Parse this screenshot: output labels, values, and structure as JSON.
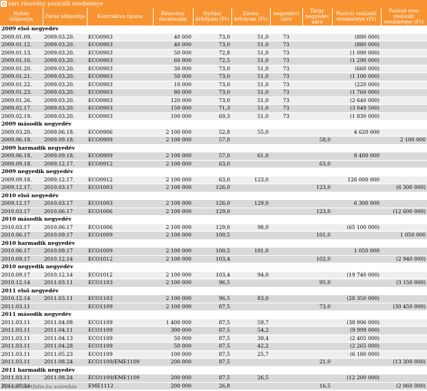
{
  "title": "zárt részvény pozíciók eredménye",
  "source": "Forrás: Portfolio.hu számítás",
  "headers": [
    "Nyitás időpontja",
    "Zárás időpontja",
    "Kontraktus típusa",
    "Részvény darabszám",
    "Nyitási árfolyam (Ft)",
    "Zárási árfolyam (Ft)",
    "negyedévi záró",
    "Tárgy negyedév záró",
    "Pozíció realizált eredménye (Ft)",
    "Pozíció nem realizált eredménye (Ft)"
  ],
  "rows": [
    {
      "q": "2009 első negyedév"
    },
    {
      "c": [
        "2009.01.09.",
        "2009.03.20.",
        "ECO0903",
        "40 000",
        "73,0",
        "51,0",
        "73",
        "",
        "(880 000)",
        ""
      ]
    },
    {
      "c": [
        "2009.01.12.",
        "2009.03.20.",
        "ECO0903",
        "40 000",
        "73,0",
        "51,0",
        "73",
        "",
        "(880 000)",
        ""
      ]
    },
    {
      "c": [
        "2009.01.13.",
        "2009.03.20.",
        "ECO0903",
        "50 000",
        "72,8",
        "51,0",
        "73",
        "",
        "(1 090 000)",
        ""
      ]
    },
    {
      "c": [
        "2009.01.16.",
        "2009.03.20.",
        "ECO0903",
        "60 000",
        "72,5",
        "51,0",
        "73",
        "",
        "(1 290 000)",
        ""
      ]
    },
    {
      "c": [
        "2009.01.20.",
        "2009.03.20.",
        "ECO0903",
        "30 000",
        "73,0",
        "51,0",
        "73",
        "",
        "(660 000)",
        ""
      ]
    },
    {
      "c": [
        "2009.01.21.",
        "2009.03.20.",
        "ECO0903",
        "50 000",
        "73,0",
        "51,0",
        "73",
        "",
        "(1 100 000)",
        ""
      ]
    },
    {
      "c": [
        "2009.01.22.",
        "2009.03.20.",
        "ECO0903",
        "10 000",
        "73,0",
        "51,0",
        "73",
        "",
        "(220 000)",
        ""
      ]
    },
    {
      "c": [
        "2009.01.23.",
        "2009.03.20.",
        "ECO0903",
        "80 000",
        "73,0",
        "51,0",
        "73",
        "",
        "(1 760 000)",
        ""
      ]
    },
    {
      "c": [
        "2009.01.26.",
        "2009.03.20.",
        "ECO0903",
        "120 000",
        "73,0",
        "51,0",
        "73",
        "",
        "(2 640 000)",
        ""
      ]
    },
    {
      "c": [
        "2009.02.17.",
        "2009.03.20.",
        "ECO0903",
        "150 000",
        "71,3",
        "51,0",
        "73",
        "",
        "(3 049 500)",
        ""
      ]
    },
    {
      "c": [
        "2009.02.19.",
        "2009.03.20.",
        "ECO0903",
        "100 000",
        "69,3",
        "51,0",
        "73",
        "",
        "(1 830 000)",
        ""
      ]
    },
    {
      "q": "2009 második negyedév"
    },
    {
      "c": [
        "2009.03.20.",
        "2009.06.18.",
        "ECO0906",
        "2 100 000",
        "52,8",
        "55,0",
        "",
        "",
        "4 620 000",
        ""
      ]
    },
    {
      "c": [
        "2009.06.18.",
        "2009.09.18.",
        "ECO0909",
        "2 100 000",
        "57,0",
        "",
        "",
        "58,0",
        "",
        "2 100 000"
      ]
    },
    {
      "q": "2009 harmadik negyedév"
    },
    {
      "c": [
        "2009.06.18.",
        "2009.09.18.",
        "ECO0909",
        "2 100 000",
        "57,0",
        "61,0",
        "",
        "",
        "8 400 000",
        ""
      ]
    },
    {
      "c": [
        "2009.09.18.",
        "2009.12.17.",
        "ECO0912",
        "2 100 000",
        "63,0",
        "",
        "",
        "63,0",
        "",
        ""
      ]
    },
    {
      "q": "2009 negyedik negyedév"
    },
    {
      "c": [
        "2009.09.18.",
        "2009.12.17.",
        "ECO0912",
        "2 100 000",
        "63,0",
        "123,0",
        "",
        "",
        "126 000 000",
        ""
      ]
    },
    {
      "c": [
        "2009.12.17.",
        "2010.03.17",
        "ECO1003",
        "2 100 000",
        "126,0",
        "",
        "",
        "123,0",
        "",
        "(6 300 000)"
      ]
    },
    {
      "q": "2010 első negyedév"
    },
    {
      "c": [
        "2009.12.17",
        "2010.03.17",
        "ECO1003",
        "2 100 000",
        "126,0",
        "129,0",
        "",
        "",
        "6 300 000",
        ""
      ]
    },
    {
      "c": [
        "2010.03.17",
        "2010.06.17",
        "ECO1006",
        "2 100 000",
        "129,0",
        "",
        "",
        "123,0",
        "",
        "(12 600 000)"
      ]
    },
    {
      "q": "2010 második negyedév"
    },
    {
      "c": [
        "2010.03.17",
        "2010.06.17",
        "ECO1006",
        "2 100 000",
        "129,0",
        "98,0",
        "",
        "",
        "(65 100 000)",
        ""
      ]
    },
    {
      "c": [
        "2010.06.17",
        "2010.09.17",
        "ECO1009",
        "2 100 000",
        "100,5",
        "",
        "",
        "101,0",
        "",
        "1 050 000"
      ]
    },
    {
      "q": "2010 harmadik negyedév"
    },
    {
      "c": [
        "2010.06.17",
        "2010.09.17",
        "ECO1009",
        "2 100 000",
        "100,5",
        "101,0",
        "",
        "",
        "1 050 000",
        ""
      ]
    },
    {
      "c": [
        "2010.09.17",
        "2010.12.14",
        "ECO1012",
        "2 100 000",
        "103,4",
        "",
        "",
        "102,0",
        "",
        "(2 940 000)"
      ]
    },
    {
      "q": "2010 negyedik negyedév"
    },
    {
      "c": [
        "2010.09.17",
        "2010.12.14",
        "ECO1012",
        "2 100 000",
        "103,4",
        "94,0",
        "",
        "",
        "(19 740 000)",
        ""
      ]
    },
    {
      "c": [
        "2010.12.14",
        "2011.03.11",
        "ECO1103",
        "2 100 000",
        "96,5",
        "",
        "",
        "95,0",
        "",
        "(3 150 000)"
      ]
    },
    {
      "q": "2011 első negyedév"
    },
    {
      "c": [
        "2010.12.14",
        "2011.03.11",
        "ECO1103",
        "2 100 000",
        "96,5",
        "83,0",
        "",
        "",
        "(28 350 000)",
        ""
      ]
    },
    {
      "c": [
        "2011.03.11",
        "",
        "ECO1109",
        "2 100 000",
        "87,5",
        "",
        "",
        "73,0",
        "",
        "(30 450 000)"
      ]
    },
    {
      "q": "2011 második negyedév"
    },
    {
      "c": [
        "2011.03.11",
        "2011.04.08",
        "ECO1109",
        "1 400 000",
        "87,5",
        "59,7",
        "",
        "",
        "(38 906 000)",
        ""
      ]
    },
    {
      "c": [
        "2011.03.11",
        "2011.04.11",
        "ECO1109",
        "300 000",
        "87,5",
        "54,2",
        "",
        "",
        "(9 999 000)",
        ""
      ]
    },
    {
      "c": [
        "2011.03.11",
        "2011.04.13",
        "ECO1109",
        "50 000",
        "87,5",
        "39,4",
        "",
        "",
        "(2 405 000)",
        ""
      ]
    },
    {
      "c": [
        "2011.03.11",
        "2011.04.28",
        "ECO1109",
        "50 000",
        "87,5",
        "42,2",
        "",
        "",
        "(2 265 000)",
        ""
      ]
    },
    {
      "c": [
        "2011.03.11",
        "2011.05.23",
        "ECO1109",
        "100 000",
        "87,5",
        "25,7",
        "",
        "",
        "(6 180 000)",
        ""
      ]
    },
    {
      "c": [
        "2011.03.11",
        "2011.08.24",
        "ECO1109/EME1109",
        "200 000",
        "87,5",
        "",
        "",
        "21,0",
        "",
        "(13 300 000)"
      ]
    },
    {
      "q": "2011 harmadik negyedév"
    },
    {
      "c": [
        "2011.03.11",
        "2011.08.24",
        "ECO1109/EME1109",
        "200 000",
        "87,5",
        "26,5",
        "",
        "",
        "(12 200 000)",
        ""
      ]
    },
    {
      "c": [
        "2011.08.24",
        "",
        "EME1112",
        "200 000",
        "26,8",
        "",
        "",
        "16,5",
        "",
        "(2 060 000)"
      ]
    }
  ]
}
